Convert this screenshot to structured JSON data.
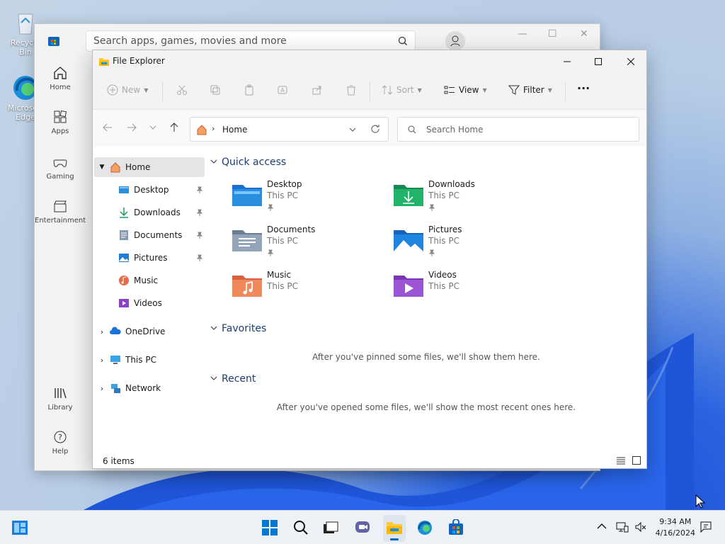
{
  "desktop": {
    "icons": [
      {
        "label": "Recycle Bin"
      },
      {
        "label": "Microsoft Edge"
      }
    ]
  },
  "store": {
    "search_placeholder": "Search apps, games, movies and more",
    "rail": [
      {
        "label": "Home",
        "icon": "home-icon"
      },
      {
        "label": "Apps",
        "icon": "apps-icon"
      },
      {
        "label": "Gaming",
        "icon": "gamepad-icon"
      },
      {
        "label": "Entertainment",
        "icon": "clapperboard-icon"
      },
      {
        "label": "Library",
        "icon": "library-icon"
      },
      {
        "label": "Help",
        "icon": "help-icon"
      }
    ]
  },
  "explorer": {
    "title": "File Explorer",
    "toolbar": {
      "new": "New",
      "sort": "Sort",
      "view": "View",
      "filter": "Filter",
      "more": "···"
    },
    "address": {
      "location": "Home"
    },
    "search": {
      "placeholder": "Search Home"
    },
    "nav": {
      "home": "Home",
      "pinned": [
        {
          "label": "Desktop",
          "pinned": true
        },
        {
          "label": "Downloads",
          "pinned": true
        },
        {
          "label": "Documents",
          "pinned": true
        },
        {
          "label": "Pictures",
          "pinned": true
        },
        {
          "label": "Music",
          "pinned": false
        },
        {
          "label": "Videos",
          "pinned": false
        }
      ],
      "onedrive": "OneDrive",
      "thispc": "This PC",
      "network": "Network"
    },
    "quick_access": {
      "title": "Quick access",
      "items": [
        {
          "name": "Desktop",
          "location": "This PC",
          "pinned": true
        },
        {
          "name": "Downloads",
          "location": "This PC",
          "pinned": true
        },
        {
          "name": "Documents",
          "location": "This PC",
          "pinned": true
        },
        {
          "name": "Pictures",
          "location": "This PC",
          "pinned": true
        },
        {
          "name": "Music",
          "location": "This PC",
          "pinned": false
        },
        {
          "name": "Videos",
          "location": "This PC",
          "pinned": false
        }
      ]
    },
    "favorites": {
      "title": "Favorites",
      "empty": "After you've pinned some files, we'll show them here."
    },
    "recent": {
      "title": "Recent",
      "empty": "After you've opened some files, we'll show the most recent ones here."
    },
    "status": {
      "count": "6 items"
    }
  },
  "taskbar": {
    "time": "9:34 AM",
    "date": "4/16/2024"
  },
  "colors": {
    "accent": "#0067c0",
    "folder": "#ffc83d"
  }
}
